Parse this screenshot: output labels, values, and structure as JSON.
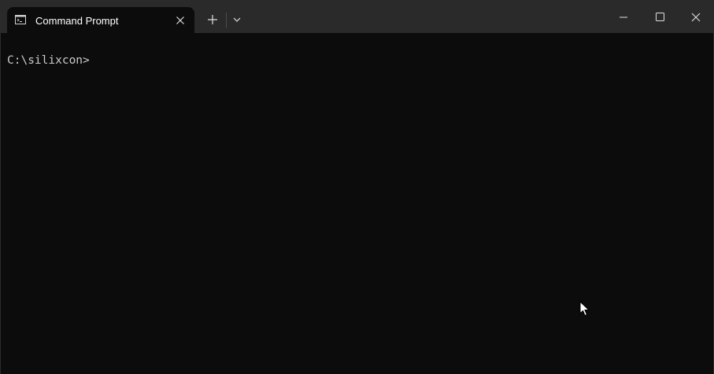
{
  "window": {
    "tab_title": "Command Prompt",
    "tab_icon": "cmd-icon",
    "new_tab_icon": "plus-icon",
    "dropdown_icon": "chevron-down-icon",
    "minimize_icon": "minimize-icon",
    "maximize_icon": "maximize-icon",
    "close_icon": "close-icon"
  },
  "terminal": {
    "prompt": "C:\\silixcon>"
  },
  "colors": {
    "titlebar": "#2a2a2a",
    "background": "#0c0c0c",
    "text": "#cccccc"
  }
}
